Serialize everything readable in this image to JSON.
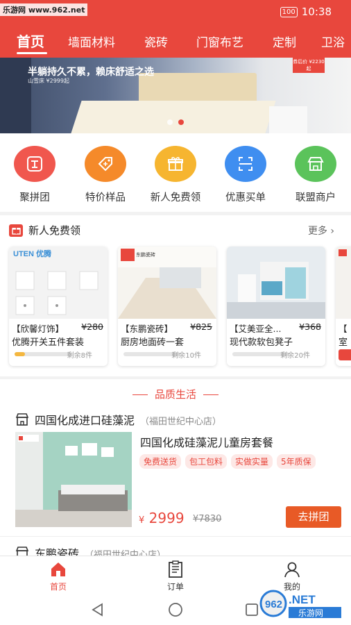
{
  "status_bar": {
    "watermark": "乐游网 www.962.net",
    "time": "10:38",
    "battery": "100"
  },
  "tabs": [
    "首页",
    "墙面材料",
    "瓷砖",
    "门窗布艺",
    "定制",
    "卫浴"
  ],
  "banner": {
    "title": "半躺持久不累，赖床舒适之选",
    "subtitle": "山雪床 ¥2999起",
    "price_tag": "券后价 ¥2230起",
    "slide_count": 2,
    "active_slide": 1
  },
  "quick_icons": [
    {
      "label": "聚拼团",
      "icon": "group-icon",
      "color": "#f0574e"
    },
    {
      "label": "特价样品",
      "icon": "discount-tag-icon",
      "color": "#f58a2a"
    },
    {
      "label": "新人免费领",
      "icon": "gift-icon",
      "color": "#f6b530"
    },
    {
      "label": "优惠买单",
      "icon": "scan-icon",
      "color": "#3f8ef0"
    },
    {
      "label": "联盟商户",
      "icon": "shop-icon",
      "color": "#5bc35b"
    }
  ],
  "new_user": {
    "title": "新人免费领",
    "more": "更多",
    "cards": [
      {
        "brand": "【欣馨灯饰】",
        "old_price": "¥280",
        "name": "优腾开关五件套装",
        "remaining": "剩余8件",
        "progress": 0.18,
        "logo": "UTEN 优腾"
      },
      {
        "brand": "【东鹏瓷砖】",
        "old_price": "¥825",
        "name": "厨房地面砖一套",
        "remaining": "剩余10件",
        "progress": 0.0,
        "logo": "东鹏瓷砖"
      },
      {
        "brand": "【艾美亚全...",
        "old_price": "¥368",
        "name": "现代款软包凳子",
        "remaining": "剩余20件",
        "progress": 0.0,
        "logo": ""
      },
      {
        "brand": "【",
        "old_price": "",
        "name": "室",
        "remaining": "",
        "progress": 0.0,
        "logo": ""
      }
    ]
  },
  "quality": {
    "title": "品质生活",
    "shops": [
      {
        "name": "四国化成进口硅藻泥",
        "location": "（福田世纪中心店）",
        "product_title": "四国化成硅藻泥儿童房套餐",
        "tags": [
          "免费送货",
          "包工包料",
          "实做实量",
          "5年质保"
        ],
        "currency": "¥",
        "price": "2999",
        "old_price": "¥7830",
        "button": "去拼团"
      },
      {
        "name": "东鹏瓷砖",
        "location": "（福田世纪中心店）"
      }
    ]
  },
  "bottom_nav": [
    {
      "label": "首页",
      "icon": "home-icon",
      "active": true
    },
    {
      "label": "订单",
      "icon": "order-icon",
      "active": false
    },
    {
      "label": "我的",
      "icon": "user-icon",
      "active": false
    }
  ],
  "bottom_watermark": "962.NET 乐游网",
  "colors": {
    "primary": "#e8473d",
    "button": "#e85a26"
  }
}
